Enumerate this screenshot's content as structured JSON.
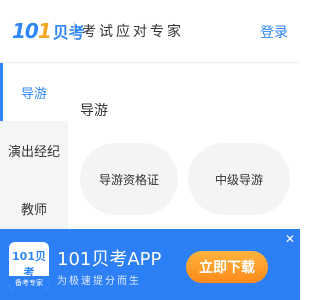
{
  "header": {
    "logo_number": "10",
    "logo_slash": "1",
    "logo_cn": "贝考",
    "slogan": "考试应对专家",
    "login_label": "登录"
  },
  "sidebar": {
    "items": [
      {
        "label": "导游",
        "active": true
      },
      {
        "label": "演出经纪",
        "active": false
      },
      {
        "label": "教师",
        "active": false
      }
    ]
  },
  "main": {
    "section_title": "导游",
    "chips": [
      {
        "label": "导游资格证"
      },
      {
        "label": "中级导游"
      }
    ]
  },
  "banner": {
    "app_icon_logo": "101贝考",
    "app_icon_caption": "备考专家",
    "app_name": "101贝考APP",
    "app_slogan": "为极速提分而生",
    "download_label": "立即下载",
    "close_icon": "close-icon"
  },
  "colors": {
    "accent": "#2f86f6",
    "banner_bg": "#2d7ff5",
    "download_button": "#ff9a24",
    "sidebar_bg": "#f4f5f7",
    "chip_bg": "#f3f4f6"
  }
}
